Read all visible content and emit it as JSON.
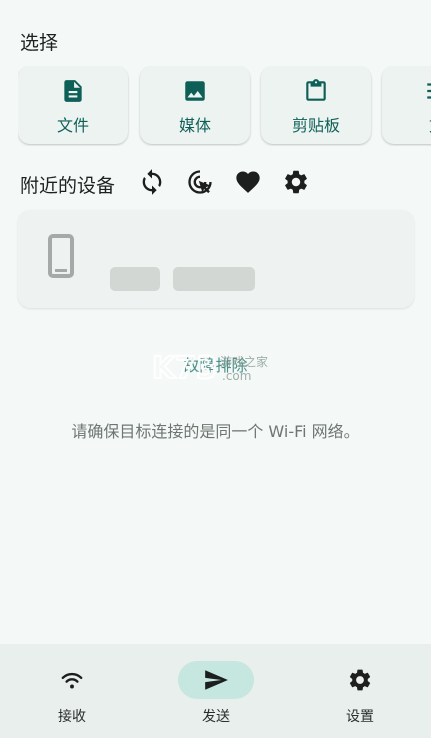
{
  "select_section": {
    "title": "选择",
    "cards": [
      {
        "label": "文件",
        "icon": "file-icon"
      },
      {
        "label": "媒体",
        "icon": "image-icon"
      },
      {
        "label": "剪贴板",
        "icon": "clipboard-icon"
      },
      {
        "label": "文",
        "icon": "text-icon"
      }
    ]
  },
  "nearby": {
    "title": "附近的设备",
    "actions": [
      "refresh-icon",
      "scan-target-icon",
      "favorite-icon",
      "settings-icon"
    ]
  },
  "troubleshoot_label": "故障排除",
  "hint_text": "请确保目标连接的是同一个 Wi-Fi 网络。",
  "watermark": {
    "brand": "K73",
    "sub": "游戏之家",
    "domain": ".com"
  },
  "bottom_nav": {
    "items": [
      {
        "label": "接收",
        "icon": "wifi-icon",
        "active": false
      },
      {
        "label": "发送",
        "icon": "send-icon",
        "active": true
      },
      {
        "label": "设置",
        "icon": "settings-icon",
        "active": false
      }
    ]
  },
  "colors": {
    "accent": "#0e5f58",
    "background": "#f4f9f7",
    "nav_active_pill": "#c5e7df",
    "link": "#4b8f86"
  }
}
